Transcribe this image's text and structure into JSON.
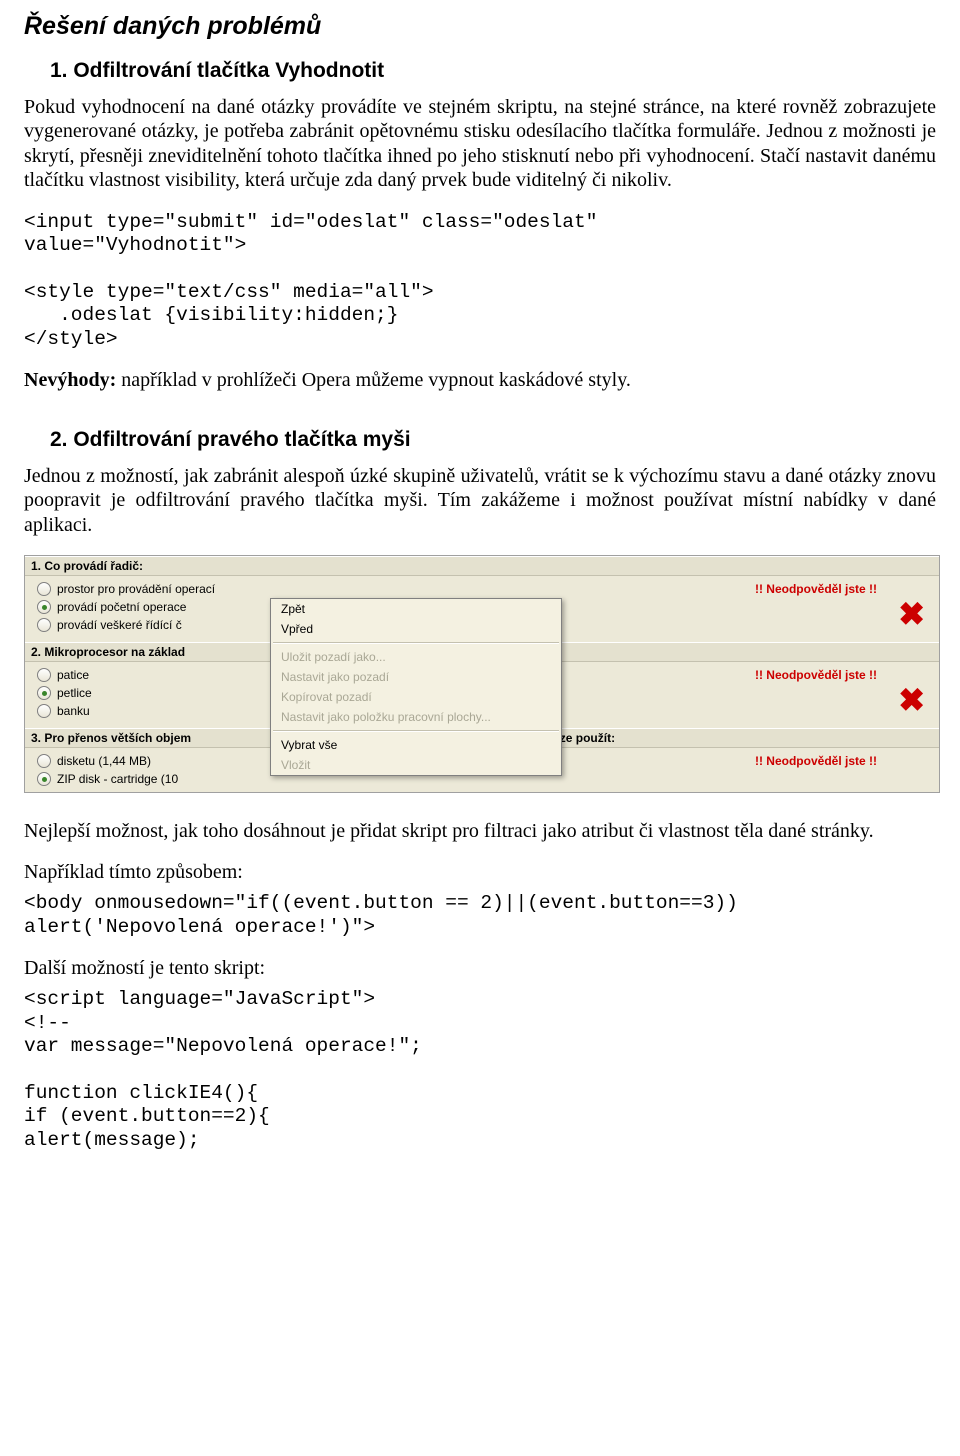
{
  "title": "Řešení daných problémů",
  "s1": {
    "heading": "1. Odfiltrování tlačítka Vyhodnotit",
    "p1": "Pokud vyhodnocení na dané otázky provádíte ve stejném skriptu, na stejné stránce, na které rovněž zobrazujete vygenerované otázky, je potřeba zabránit opětovnému stisku odesílacího tlačítka formuláře. Jednou z možnosti je skrytí, přesněji zneviditelnění tohoto tlačítka ihned po jeho stisknutí nebo při vyhodnocení. Stačí nastavit danému tlačítku vlastnost visibility, která určuje zda daný prvek bude viditelný či nikoliv.",
    "code": "<input type=\"submit\" id=\"odeslat\" class=\"odeslat\"\nvalue=\"Vyhodnotit\">\n\n<style type=\"text/css\" media=\"all\">\n   .odeslat {visibility:hidden;}\n</style>",
    "nev_label": "Nevýhody:",
    "nev_text": " například v prohlížeči Opera můžeme vypnout kaskádové styly."
  },
  "s2": {
    "heading": "2. Odfiltrování pravého tlačítka myši",
    "p1": "Jednou z možností, jak zabránit alespoň úzké skupině uživatelů, vrátit se k výchozímu stavu a dané otázky znovu poopravit je odfiltrování pravého tlačítka myši. Tím zakážeme i možnost používat místní nabídky v dané aplikaci."
  },
  "sshot": {
    "neodp": "!! Neodpověděl jste !!",
    "q1": {
      "title": "1. Co provádí řadič:",
      "opts": [
        "prostor pro provádění operací",
        "provádí početní operace",
        "provádí veškeré řídící č"
      ]
    },
    "q2": {
      "title": "2. Mikroprocesor na základ",
      "opts": [
        "patice",
        "petlice",
        "banku"
      ]
    },
    "q3": {
      "title": "3. Pro přenos větších objem",
      "title_tail": "hování dat lze použít:",
      "opts": [
        "disketu (1,44 MB)",
        "ZIP disk - cartridge (10"
      ]
    },
    "menu": {
      "zpet": "Zpět",
      "vpred": "Vpřed",
      "save_bg": "Uložit pozadí jako...",
      "set_bg": "Nastavit jako pozadí",
      "copy_bg": "Kopírovat pozadí",
      "set_desk": "Nastavit jako položku pracovní plochy...",
      "sel_all": "Vybrat vše",
      "vlozit": "Vložit"
    }
  },
  "after": {
    "p1": "Nejlepší možnost, jak toho dosáhnout je přidat skript pro filtraci jako atribut či vlastnost těla dané stránky.",
    "p2": "Například tímto způsobem:",
    "code1": "<body onmousedown=\"if((event.button == 2)||(event.button==3))\nalert('Nepovolená operace!')\">",
    "p3": "Další možností je tento skript:",
    "code2": "<script language=\"JavaScript\">\n<!--\nvar message=\"Nepovolená operace!\";\n\nfunction clickIE4(){\nif (event.button==2){\nalert(message);"
  }
}
